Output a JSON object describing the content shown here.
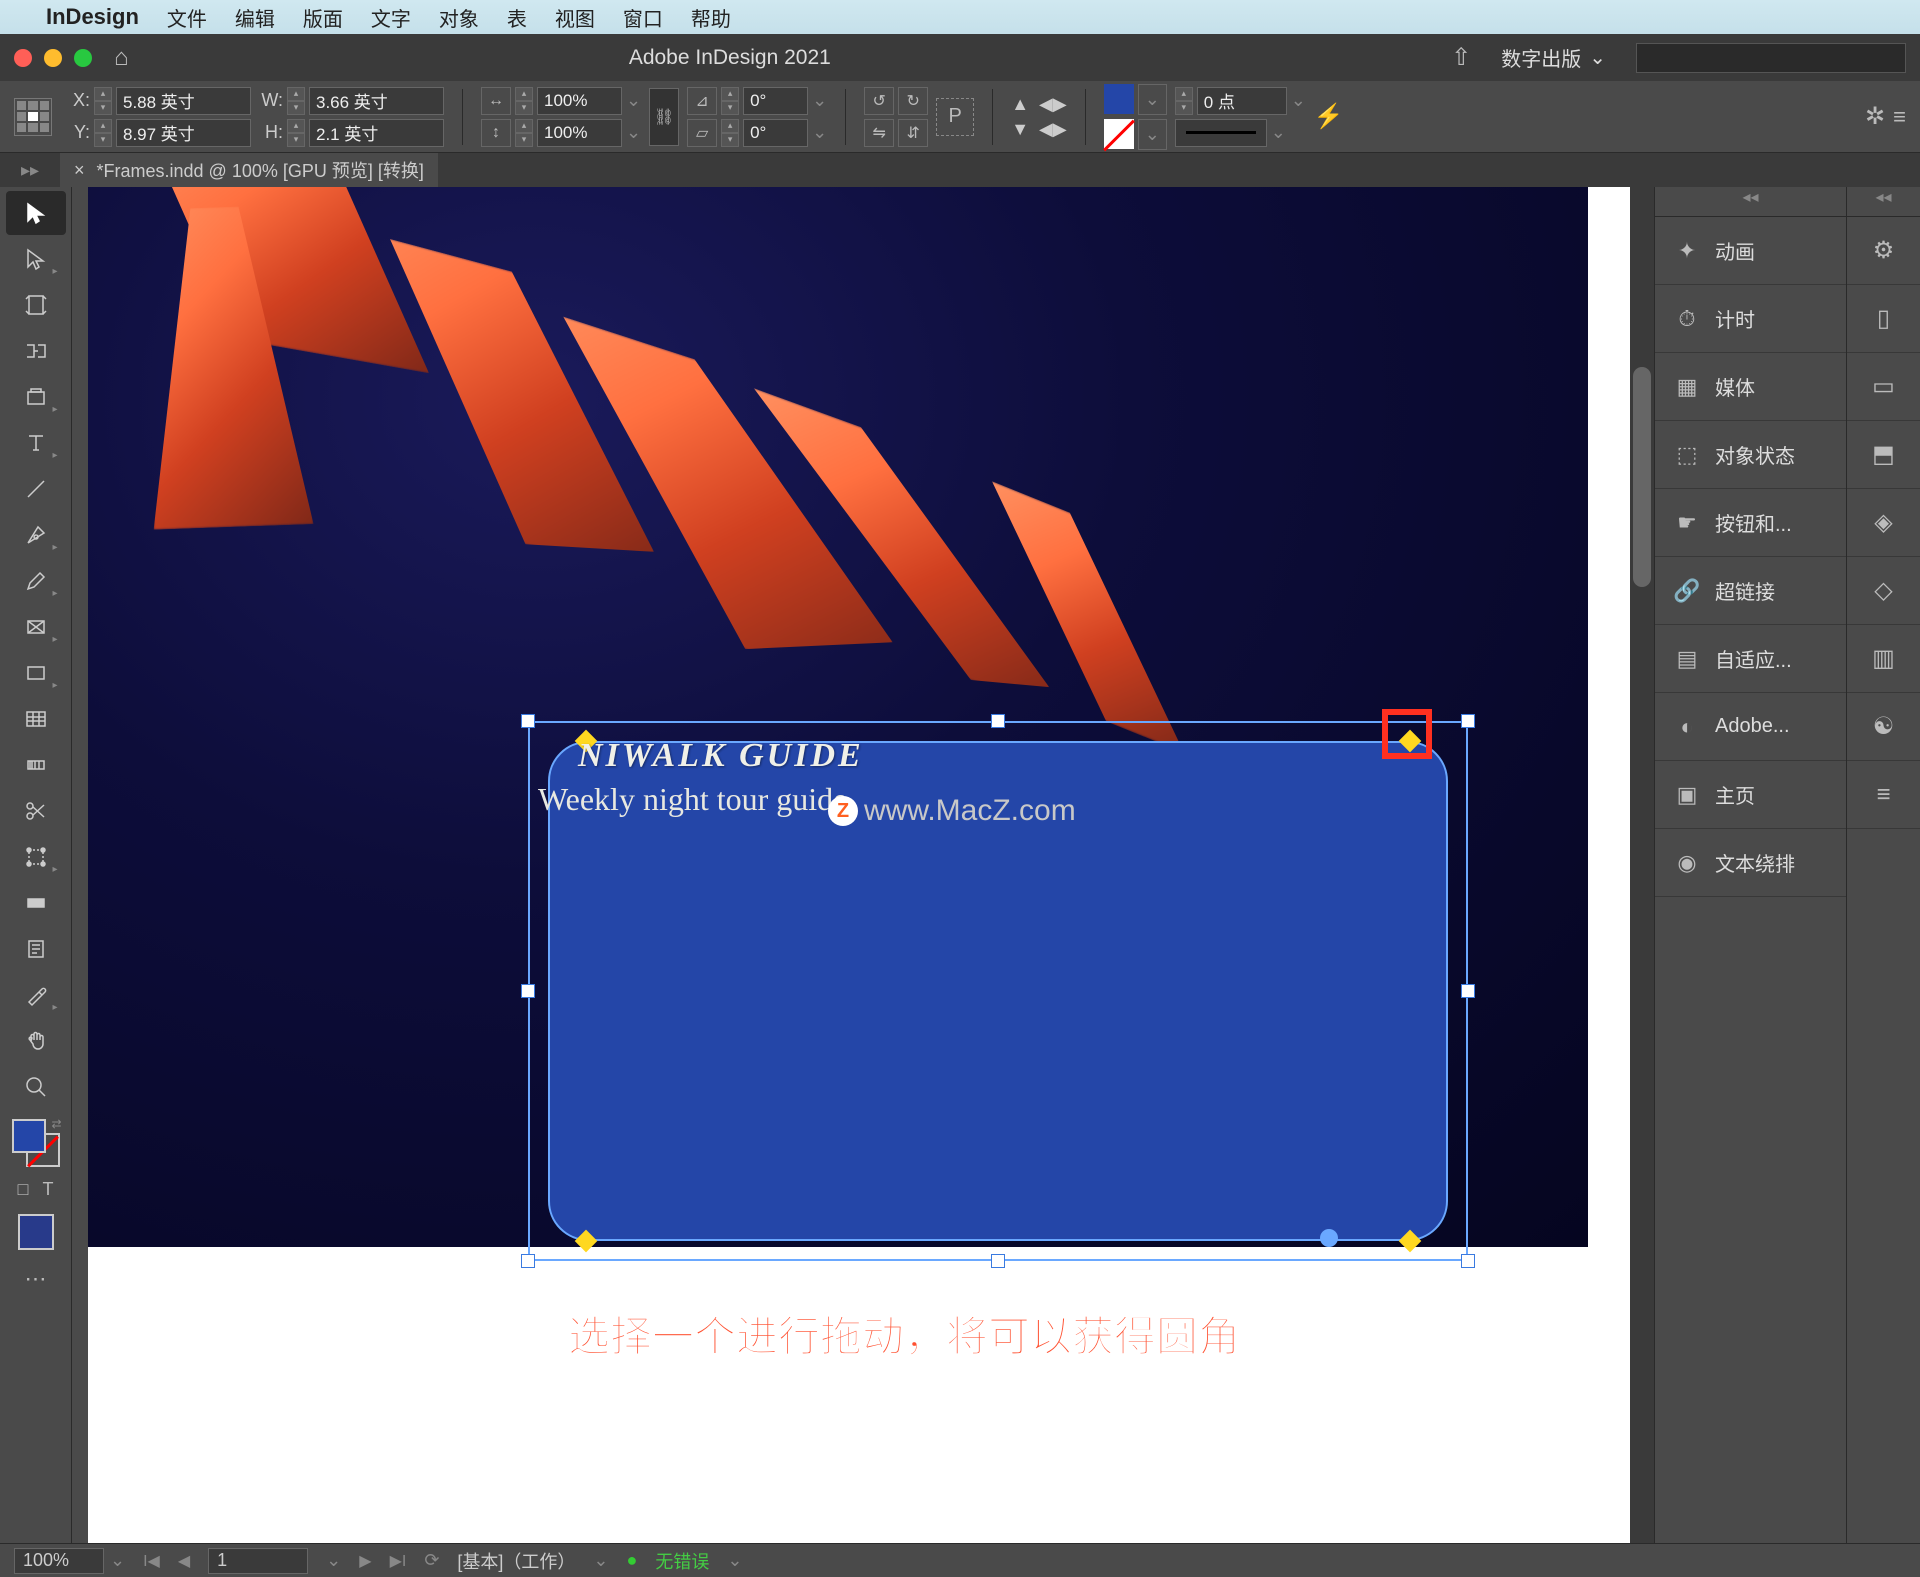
{
  "menubar": {
    "app": "InDesign",
    "items": [
      "文件",
      "编辑",
      "版面",
      "文字",
      "对象",
      "表",
      "视图",
      "窗口",
      "帮助"
    ]
  },
  "titlebar": {
    "title": "Adobe InDesign 2021",
    "workspace": "数字出版"
  },
  "controlbar": {
    "x_label": "X:",
    "x_value": "5.88 英寸",
    "y_label": "Y:",
    "y_value": "8.97 英寸",
    "w_label": "W:",
    "w_value": "3.66 英寸",
    "h_label": "H:",
    "h_value": "2.1 英寸",
    "scale_x": "100%",
    "scale_y": "100%",
    "rotate": "0°",
    "shear": "0°",
    "corner_radius": "0 点"
  },
  "document": {
    "tab": "*Frames.indd @ 100% [GPU 预览] [转换]"
  },
  "canvas": {
    "frame_title": "NIWALK  GUIDE",
    "frame_subtitle": "Weekly night tour guide",
    "watermark": "www.MacZ.com",
    "annotation": "选择一个进行拖动，将可以获得圆角"
  },
  "panels": {
    "wide": [
      {
        "icon": "✦",
        "label": "动画"
      },
      {
        "icon": "⏱",
        "label": "计时"
      },
      {
        "icon": "▦",
        "label": "媒体"
      },
      {
        "icon": "⬚",
        "label": "对象状态"
      },
      {
        "icon": "☛",
        "label": "按钮和..."
      },
      {
        "icon": "🔗",
        "label": "超链接"
      },
      {
        "icon": "▤",
        "label": "自适应..."
      },
      {
        "icon": "◐",
        "label": "Adobe..."
      },
      {
        "icon": "▣",
        "label": "主页"
      },
      {
        "icon": "◉",
        "label": "文本绕排"
      }
    ],
    "narrow": [
      "⚙",
      "▯",
      "▭",
      "⬒",
      "◈",
      "◇",
      "▥",
      "☯",
      "≡"
    ]
  },
  "statusbar": {
    "zoom": "100%",
    "page": "1",
    "preflight_profile": "[基本]（工作）",
    "preflight_status": "无错误"
  }
}
